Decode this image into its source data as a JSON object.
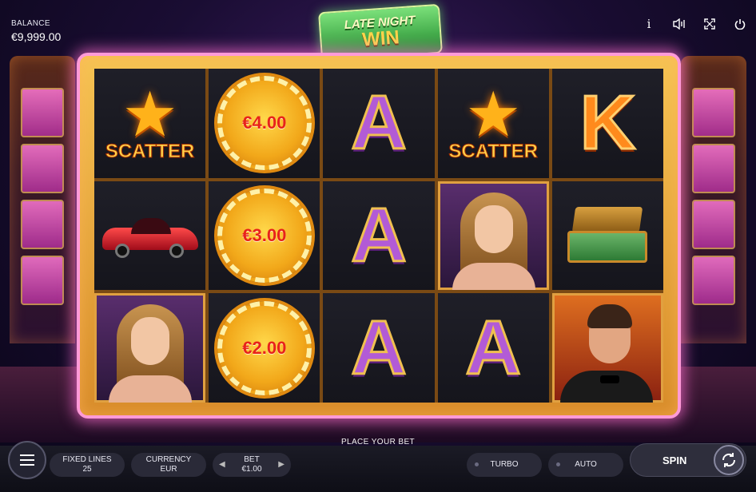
{
  "header": {
    "balance_label": "BALANCE",
    "balance_value": "€9,999.00",
    "icons": [
      "info-icon",
      "sound-icon",
      "fullscreen-icon",
      "power-icon"
    ],
    "info_glyph": "i"
  },
  "logo": {
    "line1": "LATE NIGHT",
    "line2": "WIN"
  },
  "reels": {
    "scatter_label": "SCATTER",
    "chip_values": [
      "€4.00",
      "€3.00",
      "€2.00"
    ],
    "letters": {
      "a": "A",
      "k": "K"
    }
  },
  "controls": {
    "status": "PLACE YOUR BET",
    "fixed_lines_label": "FIXED LINES",
    "fixed_lines_value": "25",
    "currency_label": "CURRENCY",
    "currency_value": "EUR",
    "bet_label": "BET",
    "bet_value": "€1.00",
    "turbo_label": "TURBO",
    "auto_label": "AUTO",
    "spin_label": "SPIN"
  },
  "colors": {
    "frame_neon": "#ff9ad8",
    "letter_purple": "#b25bd6",
    "chip_gold": "#f2a81a",
    "chip_text": "#e8231a"
  }
}
